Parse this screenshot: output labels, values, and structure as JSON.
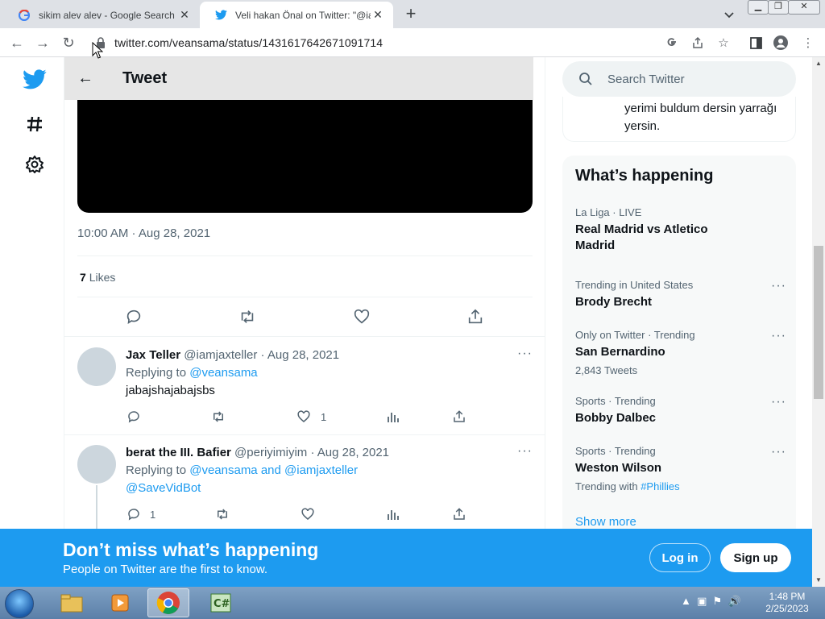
{
  "browser": {
    "tabs": [
      {
        "title": "sikim alev alev - Google Search",
        "active": false
      },
      {
        "title": "Veli hakan Önal on Twitter: \"@iam",
        "active": true
      }
    ],
    "url": "twitter.com/veansama/status/1431617642671091714"
  },
  "header": {
    "title": "Tweet"
  },
  "tweet": {
    "timestamp": "10:00 AM · Aug 28, 2021",
    "likes_count": "7",
    "likes_label": "Likes"
  },
  "replies": [
    {
      "name": "Jax Teller",
      "handle": "@iamjaxteller · Aug 28, 2021",
      "replying_prefix": "Replying to",
      "replying_to": "@veansama",
      "text": "jabajshajabajsbs",
      "like_count": "1"
    },
    {
      "name": "berat the III. Bafier",
      "handle": "@periyimiyim · Aug 28, 2021",
      "replying_prefix": "Replying to",
      "replying_to": "@veansama and @iamjaxteller",
      "replying_to_2": "@SaveVidBot",
      "reply_count": "1"
    }
  ],
  "sidebar": {
    "search_placeholder": "Search Twitter",
    "bio_text": "yerimi buldum dersin yarrağı yersin.",
    "happening_title": "What’s happening",
    "trends": [
      {
        "meta": "La Liga · LIVE",
        "name": "Real Madrid vs Atletico Madrid",
        "sub": ""
      },
      {
        "meta": "Trending in United States",
        "name": "Brody Brecht",
        "sub": ""
      },
      {
        "meta": "Only on Twitter · Trending",
        "name": "San Bernardino",
        "sub": "2,843 Tweets"
      },
      {
        "meta": "Sports · Trending",
        "name": "Bobby Dalbec",
        "sub": ""
      },
      {
        "meta": "Sports · Trending",
        "name": "Weston Wilson",
        "sub": "Trending with",
        "sub_link": "#Phillies"
      }
    ],
    "show_more": "Show more"
  },
  "banner": {
    "headline": "Don’t miss what’s happening",
    "subline": "People on Twitter are the first to know.",
    "login": "Log in",
    "signup": "Sign up"
  },
  "taskbar": {
    "time": "1:48 PM",
    "date": "2/25/2023"
  },
  "colors": {
    "twitter_blue": "#1d9bf0",
    "text_primary": "#0f1419",
    "text_secondary": "#536471"
  }
}
